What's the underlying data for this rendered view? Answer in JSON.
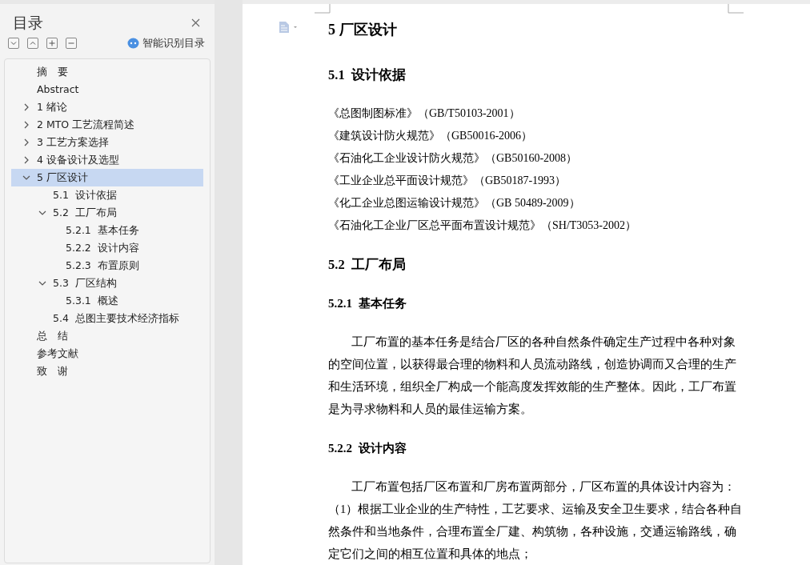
{
  "toc": {
    "title": "目录",
    "smart_button": "智能识别目录",
    "items": [
      {
        "label": "摘　要",
        "selected": false
      },
      {
        "label": "Abstract",
        "selected": false
      },
      {
        "label": "1 绪论",
        "selected": false,
        "expanded": false
      },
      {
        "label": "2 MTO 工艺流程简述",
        "selected": false,
        "expanded": false
      },
      {
        "label": "3 工艺方案选择",
        "selected": false,
        "expanded": false
      },
      {
        "label": "4 设备设计及选型",
        "selected": false,
        "expanded": false
      },
      {
        "label": "5 厂区设计",
        "selected": true,
        "expanded": true,
        "children": [
          {
            "label": "5.1  设计依据",
            "selected": false
          },
          {
            "label": "5.2  工厂布局",
            "selected": false,
            "expanded": true,
            "children": [
              {
                "label": "5.2.1  基本任务",
                "selected": false
              },
              {
                "label": "5.2.2  设计内容",
                "selected": false
              },
              {
                "label": "5.2.3  布置原则",
                "selected": false
              }
            ]
          },
          {
            "label": "5.3  厂区结构",
            "selected": false,
            "expanded": true,
            "children": [
              {
                "label": "5.3.1  概述",
                "selected": false
              }
            ]
          },
          {
            "label": "5.4  总图主要技术经济指标",
            "selected": false
          }
        ]
      },
      {
        "label": "总　结",
        "selected": false
      },
      {
        "label": "参考文献",
        "selected": false
      },
      {
        "label": "致　谢",
        "selected": false
      }
    ]
  },
  "document": [
    {
      "kind": "heading1",
      "text": "5 厂区设计"
    },
    {
      "kind": "heading2",
      "text": "5.1  设计依据"
    },
    {
      "kind": "reference",
      "text": "《总图制图标准》（GB/T50103-2001）"
    },
    {
      "kind": "reference",
      "text": "《建筑设计防火规范》（GB50016-2006）"
    },
    {
      "kind": "reference",
      "text": "《石油化工企业设计防火规范》（GB50160-2008）"
    },
    {
      "kind": "reference",
      "text": "《工业企业总平面设计规范》（GB50187-1993）"
    },
    {
      "kind": "reference",
      "text": "《化工企业总图运输设计规范》（GB 50489-2009）"
    },
    {
      "kind": "reference",
      "text": "《石油化工企业厂区总平面布置设计规范》（SH/T3053-2002）"
    },
    {
      "kind": "heading2",
      "text": "5.2  工厂布局"
    },
    {
      "kind": "heading3",
      "text": "5.2.1  基本任务"
    },
    {
      "kind": "paragraph",
      "text": "工厂布置的基本任务是结合厂区的各种自然条件确定生产过程中各种对象的空间位置，以获得最合理的物料和人员流动路线，创造协调而又合理的生产和生活环境，组织全厂构成一个能高度发挥效能的生产整体。因此，工厂布置是为寻求物料和人员的最佳运输方案。"
    },
    {
      "kind": "heading3",
      "text": "5.2.2  设计内容"
    },
    {
      "kind": "paragraph",
      "text": "工厂布置包括厂区布置和厂房布置两部分，厂区布置的具体设计内容为："
    },
    {
      "kind": "list_item",
      "text": "（1）根据工业企业的生产特性，工艺要求、运输及安全卫生要求，结合各种自然条件和当地条件，合理布置全厂建、构筑物，各种设施，交通运输路线，确定它们之间的相互位置和具体的地点；"
    }
  ]
}
